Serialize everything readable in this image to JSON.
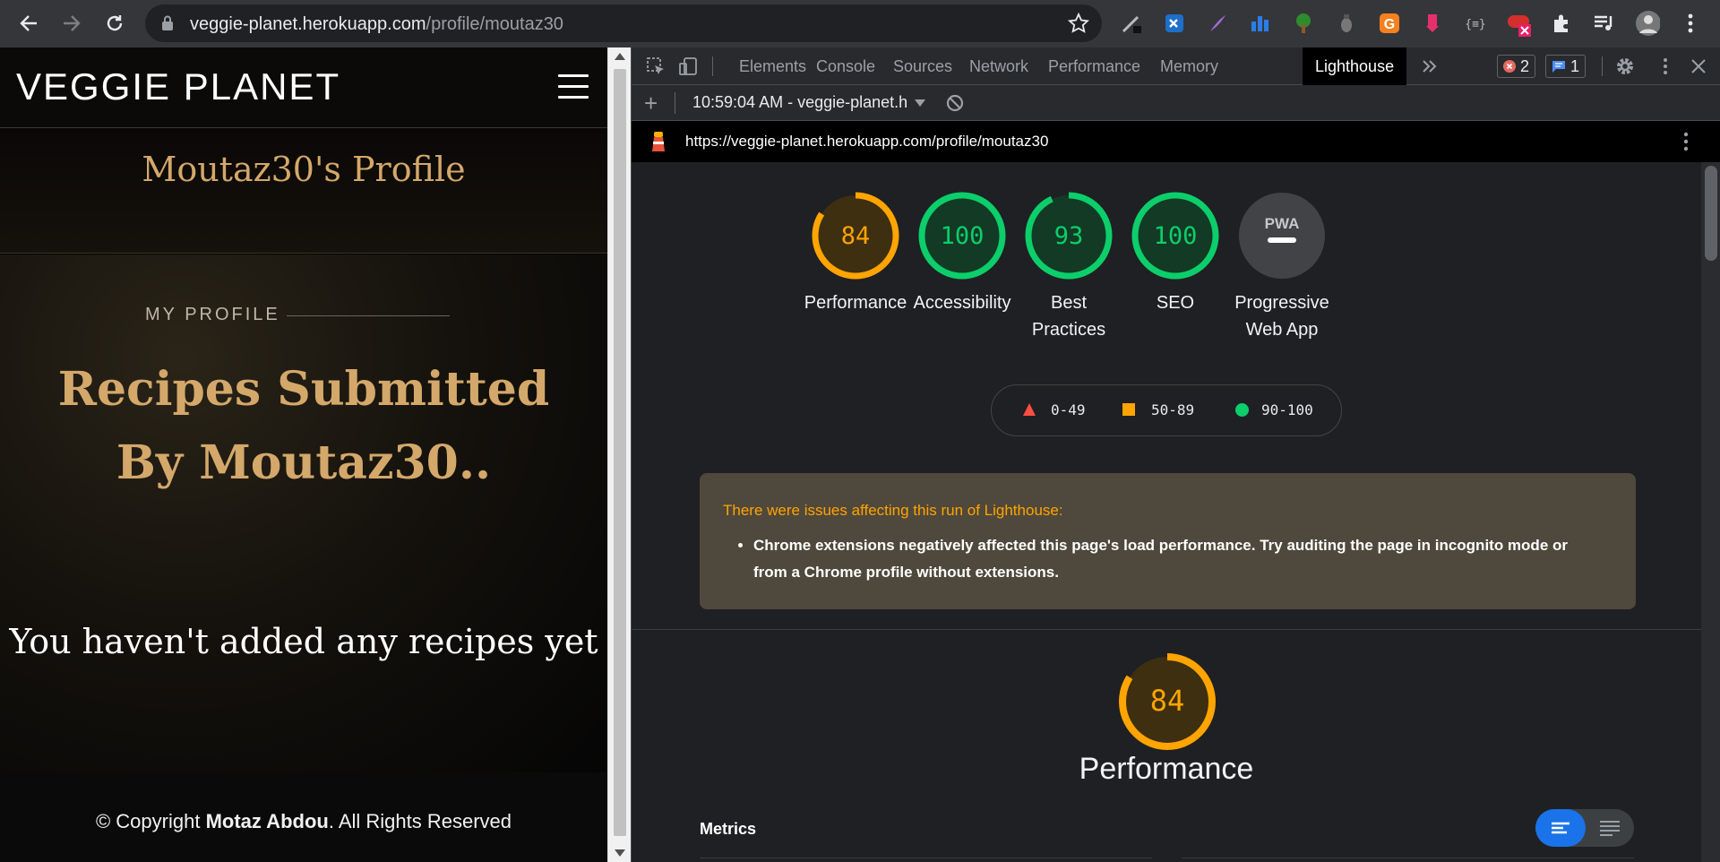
{
  "browser": {
    "url_domain": "veggie-planet.herokuapp.com",
    "url_path": "/profile/moutaz30"
  },
  "page": {
    "brand": "VEGGIE PLANET",
    "profile_title": "Moutaz30's Profile",
    "section_label": "MY PROFILE",
    "recipes_heading": "Recipes Submitted By Moutaz30..",
    "empty_message": "You haven't added any recipes yet",
    "footer": {
      "prefix": "© Copyright ",
      "author": "Motaz Abdou",
      "suffix": ". All Rights Reserved"
    }
  },
  "devtools": {
    "tabs": [
      "Elements",
      "Console",
      "Sources",
      "Network",
      "Performance",
      "Memory",
      "Lighthouse"
    ],
    "active_tab": "Lighthouse",
    "error_count": "2",
    "message_count": "1",
    "report_label": "10:59:04 AM - veggie-planet.h",
    "lighthouse_url": "https://veggie-planet.herokuapp.com/profile/moutaz30"
  },
  "lighthouse": {
    "scores": [
      {
        "label_1": "Performance",
        "label_2": "",
        "score": 84,
        "color": "#ffa400"
      },
      {
        "label_1": "Accessibility",
        "label_2": "",
        "score": 100,
        "color": "#0cce6b"
      },
      {
        "label_1": "Best",
        "label_2": "Practices",
        "score": 93,
        "color": "#0cce6b"
      },
      {
        "label_1": "SEO",
        "label_2": "",
        "score": 100,
        "color": "#0cce6b"
      },
      {
        "label_1": "Progressive",
        "label_2": "Web App",
        "score": null,
        "color": "#9aa0a6",
        "badge": "PWA"
      }
    ],
    "legend": [
      {
        "range": "0-49",
        "color": "#ff4e42",
        "shape": "triangle"
      },
      {
        "range": "50-89",
        "color": "#ffa400",
        "shape": "square"
      },
      {
        "range": "90-100",
        "color": "#0cce6b",
        "shape": "circle"
      }
    ],
    "issues_title": "There were issues affecting this run of Lighthouse:",
    "issues": [
      "Chrome extensions negatively affected this page's load performance. Try auditing the page in incognito mode or from a Chrome profile without extensions."
    ],
    "performance_score": "84",
    "performance_title": "Performance",
    "metrics_label": "Metrics"
  },
  "colors": {
    "gold": "#d4a86a",
    "orange": "#ffa400",
    "green": "#0cce6b",
    "blue": "#1a73e8"
  }
}
